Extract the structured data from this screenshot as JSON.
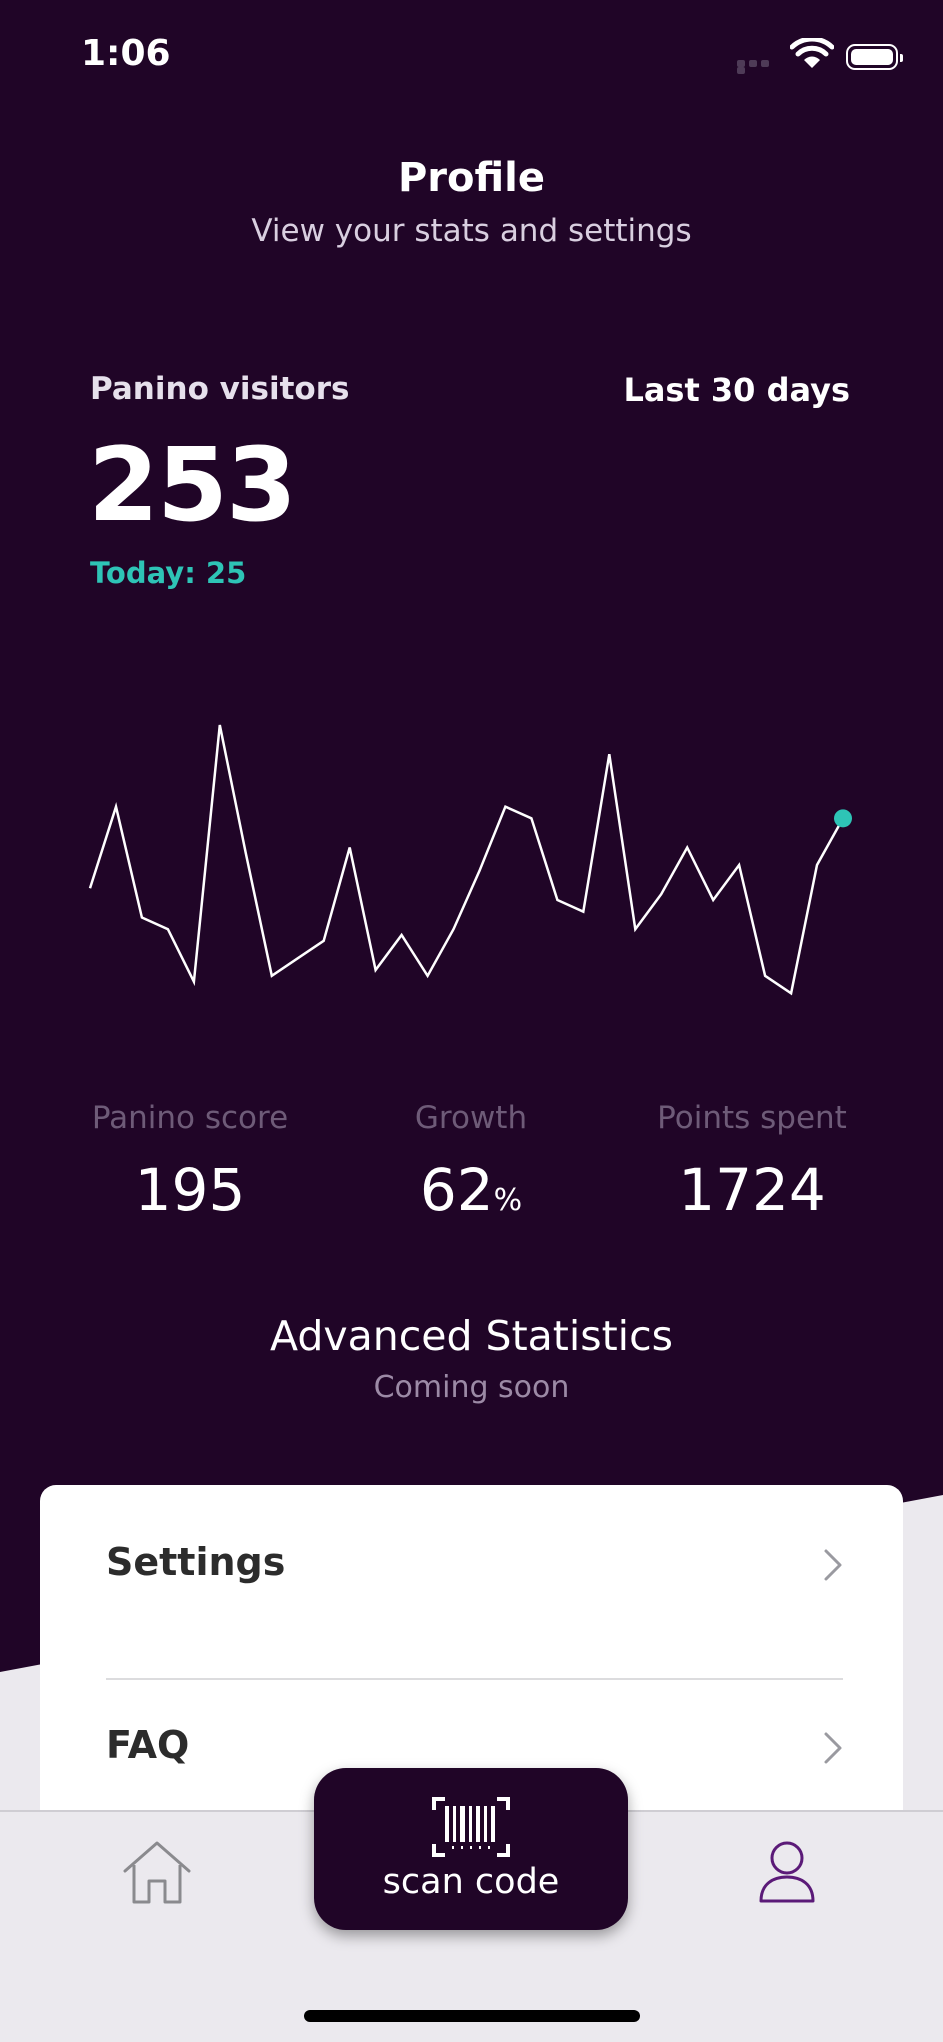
{
  "status_bar": {
    "time": "1:06"
  },
  "header": {
    "title": "Profile",
    "subtitle": "View your stats and settings"
  },
  "visitors": {
    "label": "Panino visitors",
    "range": "Last 30 days",
    "value": "253",
    "today": "Today: 25"
  },
  "chart_data": {
    "type": "line",
    "values": [
      26,
      40,
      21,
      19,
      10,
      54,
      32,
      11,
      14,
      17,
      33,
      12,
      18,
      11,
      19,
      29,
      40,
      38,
      24,
      22,
      49,
      19,
      25,
      33,
      24,
      30,
      11,
      8,
      30,
      38
    ],
    "ylim": [
      0,
      60
    ],
    "colors": {
      "line": "#ffffff",
      "last_point": "#2ec4b6"
    }
  },
  "stats": [
    {
      "label": "Panino score",
      "value": "195",
      "unit": ""
    },
    {
      "label": "Growth",
      "value": "62",
      "unit": "%"
    },
    {
      "label": "Points spent",
      "value": "1724",
      "unit": ""
    }
  ],
  "advanced": {
    "title": "Advanced Statistics",
    "subtitle": "Coming soon"
  },
  "menu": {
    "settings_label": "Settings",
    "faq_label": "FAQ"
  },
  "tabbar": {
    "scan_label": "scan code",
    "home_icon": "home-icon",
    "profile_icon": "profile-icon"
  },
  "colors": {
    "background": "#200527",
    "accent": "#2ec4b6",
    "profile_tab": "#5b1a78"
  }
}
